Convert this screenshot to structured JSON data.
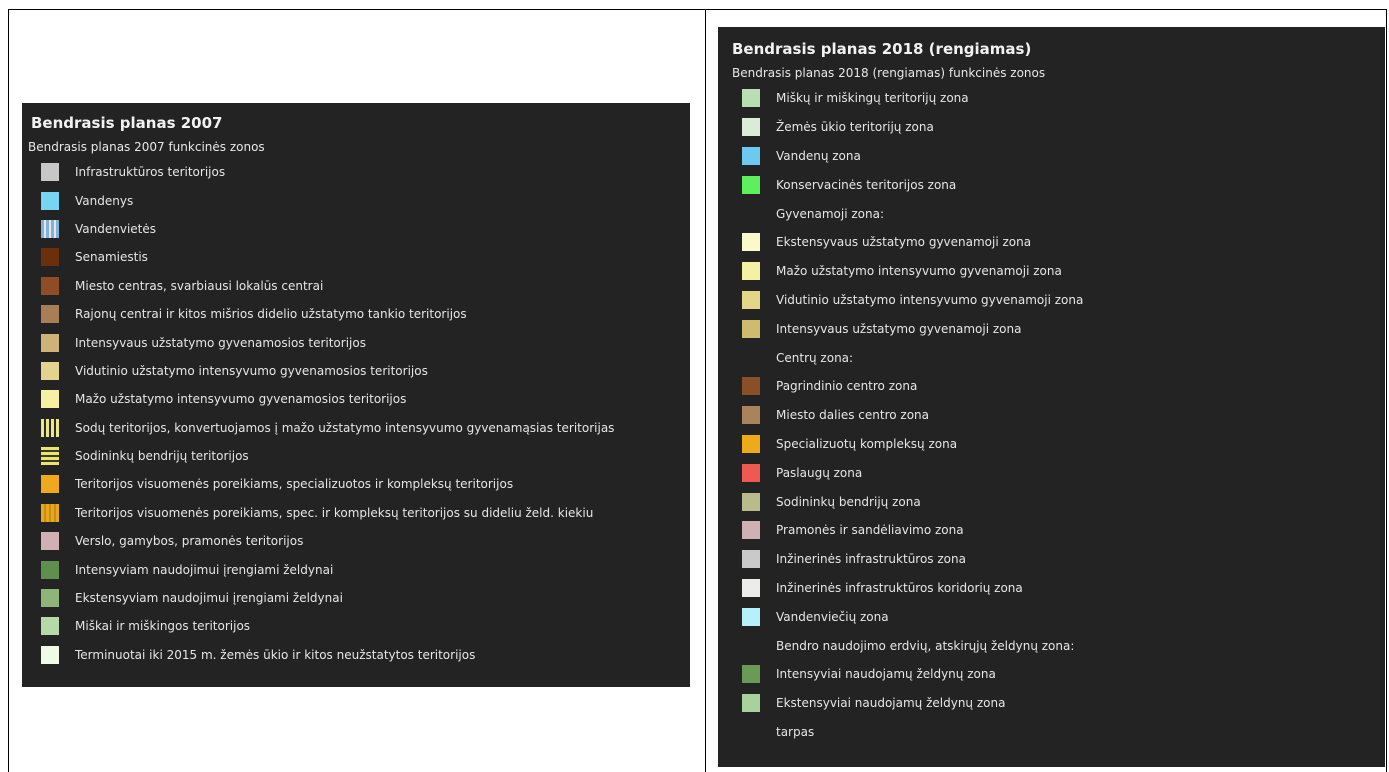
{
  "left_panel": {
    "title": "Bendrasis planas 2007",
    "subtitle": "Bendrasis planas 2007 funkcinės zonos",
    "items": [
      {
        "label": "Infrastruktūros teritorijos",
        "color": "#c7c7c7",
        "pattern": "",
        "icon": "swatch-icon"
      },
      {
        "label": "Vandenys",
        "color": "#77d4f2",
        "pattern": "",
        "icon": "swatch-icon"
      },
      {
        "label": "Vandenvietės",
        "color": "#7fb3d9",
        "pattern": "pat-vstripe-blue",
        "icon": "vertical-stripe-swatch-icon"
      },
      {
        "label": "Senamiestis",
        "color": "#6b2f0c",
        "pattern": "",
        "icon": "swatch-icon"
      },
      {
        "label": "Miesto centras, svarbiausi lokalūs centrai",
        "color": "#8e4d26",
        "pattern": "",
        "icon": "swatch-icon"
      },
      {
        "label": "Rajonų centrai ir kitos mišrios didelio užstatymo tankio teritorijos",
        "color": "#a87e57",
        "pattern": "",
        "icon": "swatch-icon"
      },
      {
        "label": "Intensyvaus užstatymo gyvenamosios teritorijos",
        "color": "#cdb377",
        "pattern": "",
        "icon": "swatch-icon"
      },
      {
        "label": "Vidutinio užstatymo intensyvumo gyvenamosios teritorijos",
        "color": "#e2d38f",
        "pattern": "",
        "icon": "swatch-icon"
      },
      {
        "label": "Mažo užstatymo intensyvumo gyvenamosios teritorijos",
        "color": "#f5f0a3",
        "pattern": "",
        "icon": "swatch-icon"
      },
      {
        "label": "Sodų teritorijos, konvertuojamos į mažo užstatymo intensyvumo gyvenamąsias teritorijas",
        "color": "#ebe88a",
        "pattern": "pat-vstripe-yellow",
        "icon": "vertical-stripe-swatch-icon"
      },
      {
        "label": "Sodininkų bendrijų teritorijos",
        "color": "#e7e46f",
        "pattern": "pat-hstripe-yellow",
        "icon": "horizontal-stripe-swatch-icon"
      },
      {
        "label": "Teritorijos visuomenės poreikiams, specializuotos ir kompleksų teritorijos",
        "color": "#f0a81c",
        "pattern": "",
        "icon": "swatch-icon"
      },
      {
        "label": "Teritorijos visuomenės poreikiams, spec. ir kompleksų teritorijos su dideliu želd. kiekiu",
        "color": "#e5a820",
        "pattern": "pat-vstripe-orange",
        "icon": "vertical-stripe-swatch-icon"
      },
      {
        "label": "Verslo, gamybos, pramonės teritorijos",
        "color": "#cfb0b3",
        "pattern": "",
        "icon": "swatch-icon"
      },
      {
        "label": "Intensyviam naudojimui įrengiami želdynai",
        "color": "#5f8f4c",
        "pattern": "",
        "icon": "swatch-icon"
      },
      {
        "label": "Ekstensyviam naudojimui įrengiami želdynai",
        "color": "#8fb47a",
        "pattern": "",
        "icon": "swatch-icon"
      },
      {
        "label": "Miškai ir miškingos teritorijos",
        "color": "#b7d9a9",
        "pattern": "",
        "icon": "swatch-icon"
      },
      {
        "label": "Terminuotai iki 2015 m. žemės ūkio ir kitos neužstatytos teritorijos",
        "color": "#f0fbe6",
        "pattern": "",
        "icon": "swatch-icon"
      }
    ]
  },
  "right_panel": {
    "title": "Bendrasis planas 2018 (rengiamas)",
    "subtitle": "Bendrasis planas 2018 (rengiamas) funkcinės zonos",
    "items": [
      {
        "label": "Miškų ir miškingų teritorijų zona",
        "color": "#b7dfb1",
        "icon": "swatch-icon"
      },
      {
        "label": "Žemės ūkio teritorijų zona",
        "color": "#d9ecd6",
        "icon": "swatch-icon"
      },
      {
        "label": "Vandenų zona",
        "color": "#6cc9f0",
        "icon": "swatch-icon"
      },
      {
        "label": "Konservacinės teritorijos zona",
        "color": "#5ef05c",
        "icon": "swatch-icon"
      },
      {
        "label": "Gyvenamoji zona:",
        "color": "",
        "icon": "empty-swatch-icon"
      },
      {
        "label": "Ekstensyvaus užstatymo gyvenamoji zona",
        "color": "#fbf8c9",
        "icon": "swatch-icon"
      },
      {
        "label": "Mažo užstatymo intensyvumo gyvenamoji zona",
        "color": "#f5f1a2",
        "icon": "swatch-icon"
      },
      {
        "label": "Vidutinio užstatymo intensyvumo gyvenamoji zona",
        "color": "#e3d689",
        "icon": "swatch-icon"
      },
      {
        "label": "Intensyvaus užstatymo gyvenamoji zona",
        "color": "#cfbb6e",
        "icon": "swatch-icon"
      },
      {
        "label": "Centrų zona:",
        "color": "",
        "icon": "empty-swatch-icon"
      },
      {
        "label": "Pagrindinio centro zona",
        "color": "#8a4f26",
        "icon": "swatch-icon"
      },
      {
        "label": "Miesto dalies centro zona",
        "color": "#a8835b",
        "icon": "swatch-icon"
      },
      {
        "label": "Specializuotų kompleksų zona",
        "color": "#edab1a",
        "icon": "swatch-icon"
      },
      {
        "label": "Paslaugų zona",
        "color": "#ee5a52",
        "icon": "swatch-icon"
      },
      {
        "label": "Sodininkų bendrijų zona",
        "color": "#b9bb8a",
        "icon": "swatch-icon"
      },
      {
        "label": "Pramonės ir sandėliavimo zona",
        "color": "#cfb0b3",
        "icon": "swatch-icon"
      },
      {
        "label": "Inžinerinės infrastruktūros zona",
        "color": "#c9c9c9",
        "icon": "swatch-icon"
      },
      {
        "label": "Inžinerinės infrastruktūros koridorių zona",
        "color": "#ececea",
        "icon": "swatch-icon"
      },
      {
        "label": "Vandenviečių zona",
        "color": "#b5f0fb",
        "icon": "swatch-icon"
      },
      {
        "label": "Bendro naudojimo erdvių, atskirųjų želdynų zona:",
        "color": "",
        "icon": "empty-swatch-icon"
      },
      {
        "label": "Intensyviai naudojamų želdynų zona",
        "color": "#6a9a55",
        "icon": "swatch-icon"
      },
      {
        "label": "Ekstensyviai naudojamų želdynų zona",
        "color": "#a9d19c",
        "icon": "swatch-icon"
      },
      {
        "label": "tarpas",
        "color": "",
        "icon": "empty-swatch-icon"
      }
    ]
  }
}
